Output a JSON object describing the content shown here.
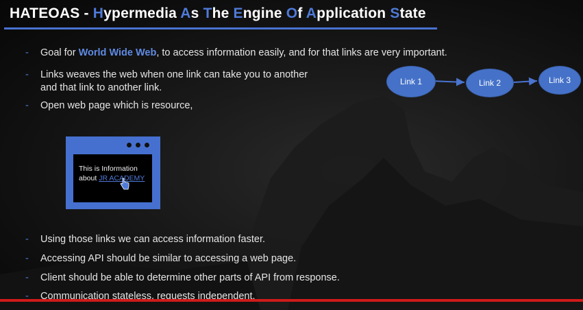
{
  "title": {
    "segments": [
      {
        "text": "HATEOAS - ",
        "hl": false
      },
      {
        "text": "H",
        "hl": true
      },
      {
        "text": "ypermedia ",
        "hl": false
      },
      {
        "text": "A",
        "hl": true
      },
      {
        "text": "s ",
        "hl": false
      },
      {
        "text": "T",
        "hl": true
      },
      {
        "text": "he ",
        "hl": false
      },
      {
        "text": "E",
        "hl": true
      },
      {
        "text": "ngine ",
        "hl": false
      },
      {
        "text": "O",
        "hl": true
      },
      {
        "text": "f ",
        "hl": false
      },
      {
        "text": "A",
        "hl": true
      },
      {
        "text": "pplication ",
        "hl": false
      },
      {
        "text": "S",
        "hl": true
      },
      {
        "text": "tate",
        "hl": false
      }
    ]
  },
  "bullet_marker": "-",
  "bullets": {
    "b1": {
      "pre": "Goal for ",
      "strong": "World Wide Web",
      "post": ", to access information easily, and for that links are very important."
    },
    "b2": {
      "line1": "Links weaves the web when one link can take you to another",
      "line2": "and that link to another link."
    },
    "b3": "Open web page which is resource,",
    "b4": "Using those links we can access information faster.",
    "b5": "Accessing API should be similar to accessing a web page.",
    "b6": "Client should be able to determine other parts of API from response.",
    "b7": "Communication stateless, requests independent."
  },
  "browser": {
    "line1": "This is Information",
    "line2_pre": "about ",
    "link": "JR ACADEMY"
  },
  "diagram": {
    "nodes": [
      "Link 1",
      "Link 2",
      "Link 3"
    ]
  },
  "colors": {
    "accent": "#4f7ad8",
    "node_fill": "#4572c8",
    "bottom_rule": "#d01a1a"
  }
}
